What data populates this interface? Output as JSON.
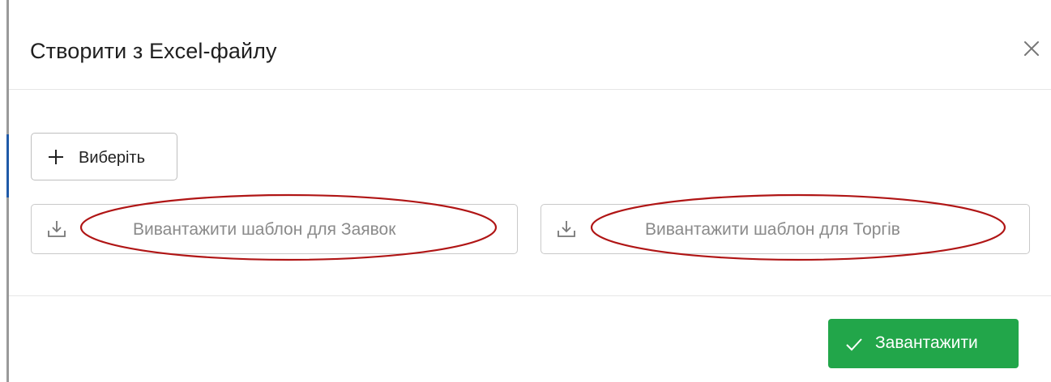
{
  "modal": {
    "title": "Створити з Excel-файлу"
  },
  "body": {
    "choose_label": "Виберіть",
    "download_applications_label": "Вивантажити шаблон для Заявок",
    "download_trades_label": "Вивантажити шаблон для Торгів"
  },
  "footer": {
    "submit_label": "Завантажити"
  },
  "colors": {
    "submit_green": "#22a64a",
    "annotation_red": "#b01515",
    "accent_blue": "#1f5aa8"
  },
  "icons": {
    "close": "close-icon",
    "choose": "plus-icon",
    "download": "download-icon",
    "submit": "check-icon"
  }
}
